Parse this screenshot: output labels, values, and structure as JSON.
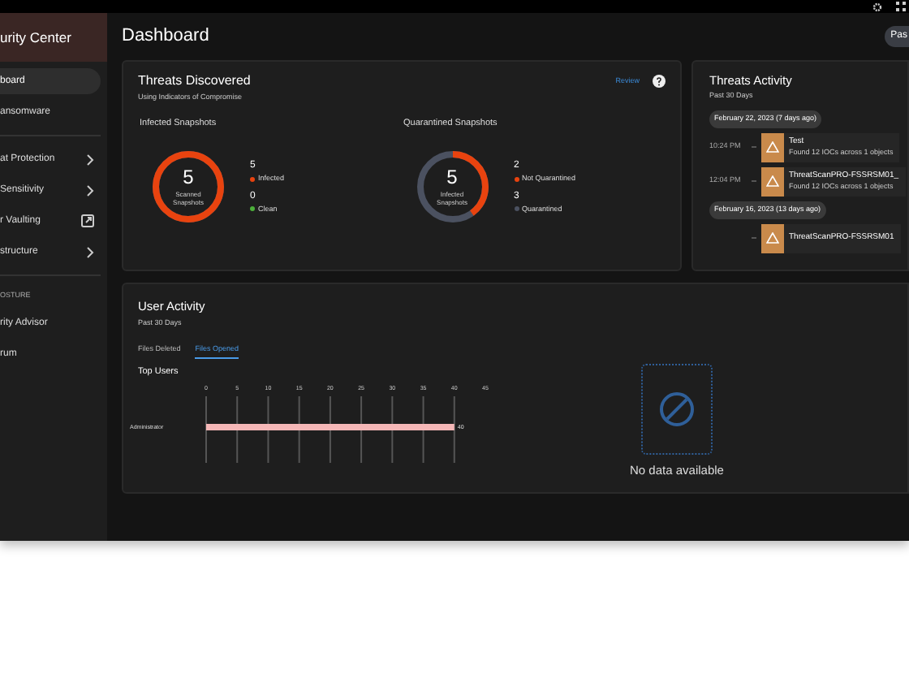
{
  "sidebar": {
    "title": "urity Center",
    "items": [
      {
        "label": "board",
        "kind": "link",
        "selected": true
      },
      {
        "label": "ansomware",
        "kind": "link",
        "selected": false
      },
      {
        "kind": "divider"
      },
      {
        "label": "at Protection",
        "kind": "submenu",
        "selected": false
      },
      {
        "label": "Sensitivity",
        "kind": "submenu",
        "selected": false
      },
      {
        "label": "r Vaulting",
        "kind": "external",
        "selected": false
      },
      {
        "label": "structure",
        "kind": "submenu",
        "selected": false
      },
      {
        "kind": "divider"
      },
      {
        "label": "OSTURE",
        "kind": "section"
      },
      {
        "label": "rity Advisor",
        "kind": "link",
        "selected": false
      },
      {
        "label": "rum",
        "kind": "link",
        "selected": false
      }
    ]
  },
  "header": {
    "title": "Dashboard",
    "button": "Pas"
  },
  "threats_discovered": {
    "title": "Threats Discovered",
    "subtitle": "Using Indicators of Compromise",
    "review": "Review",
    "panels": [
      {
        "title": "Infected Snapshots",
        "value": "5",
        "caption": "Scanned Snapshots",
        "level": 1,
        "legend": [
          {
            "count": "5",
            "label": "Infected",
            "color": "#e8430f"
          },
          {
            "count": "0",
            "label": "Clean",
            "color": "#4caf3a"
          }
        ]
      },
      {
        "title": "Quarantined Snapshots",
        "value": "5",
        "caption": "Infected Snapshots",
        "level": 0.4,
        "legend": [
          {
            "count": "2",
            "label": "Not Quarantined",
            "color": "#e8430f"
          },
          {
            "count": "3",
            "label": "Quarantined",
            "color": "#4b5160"
          }
        ]
      }
    ]
  },
  "threats_activity": {
    "title": "Threats Activity",
    "subtitle": "Past 30 Days",
    "groups": [
      {
        "date": "February 22, 2023 (7 days ago)",
        "events": [
          {
            "time": "10:24 PM",
            "name": "Test",
            "detail": "Found 12 IOCs across 1 objects"
          },
          {
            "time": "12:04 PM",
            "name": "ThreatScanPRO-FSSRSM01_",
            "detail": "Found 12 IOCs across 1 objects"
          }
        ]
      },
      {
        "date": "February 16, 2023 (13 days ago)",
        "events": [
          {
            "name": "ThreatScanPRO-FSSRSM01"
          }
        ]
      }
    ]
  },
  "user_activity": {
    "title": "User Activity",
    "subtitle": "Past 30 Days",
    "tabs": [
      {
        "label": "Files Deleted",
        "selected": false
      },
      {
        "label": "Files Opened",
        "selected": true
      }
    ],
    "chart_title": "Top Users",
    "chart_data": {
      "type": "bar",
      "orientation": "horizontal",
      "categories": [
        "Administrator"
      ],
      "values": [
        40
      ],
      "xlim": [
        0,
        45
      ],
      "xticks": [
        0,
        5,
        10,
        15,
        20,
        25,
        30,
        35,
        40,
        45
      ],
      "data_labels": true
    },
    "empty_text": "No data available"
  }
}
